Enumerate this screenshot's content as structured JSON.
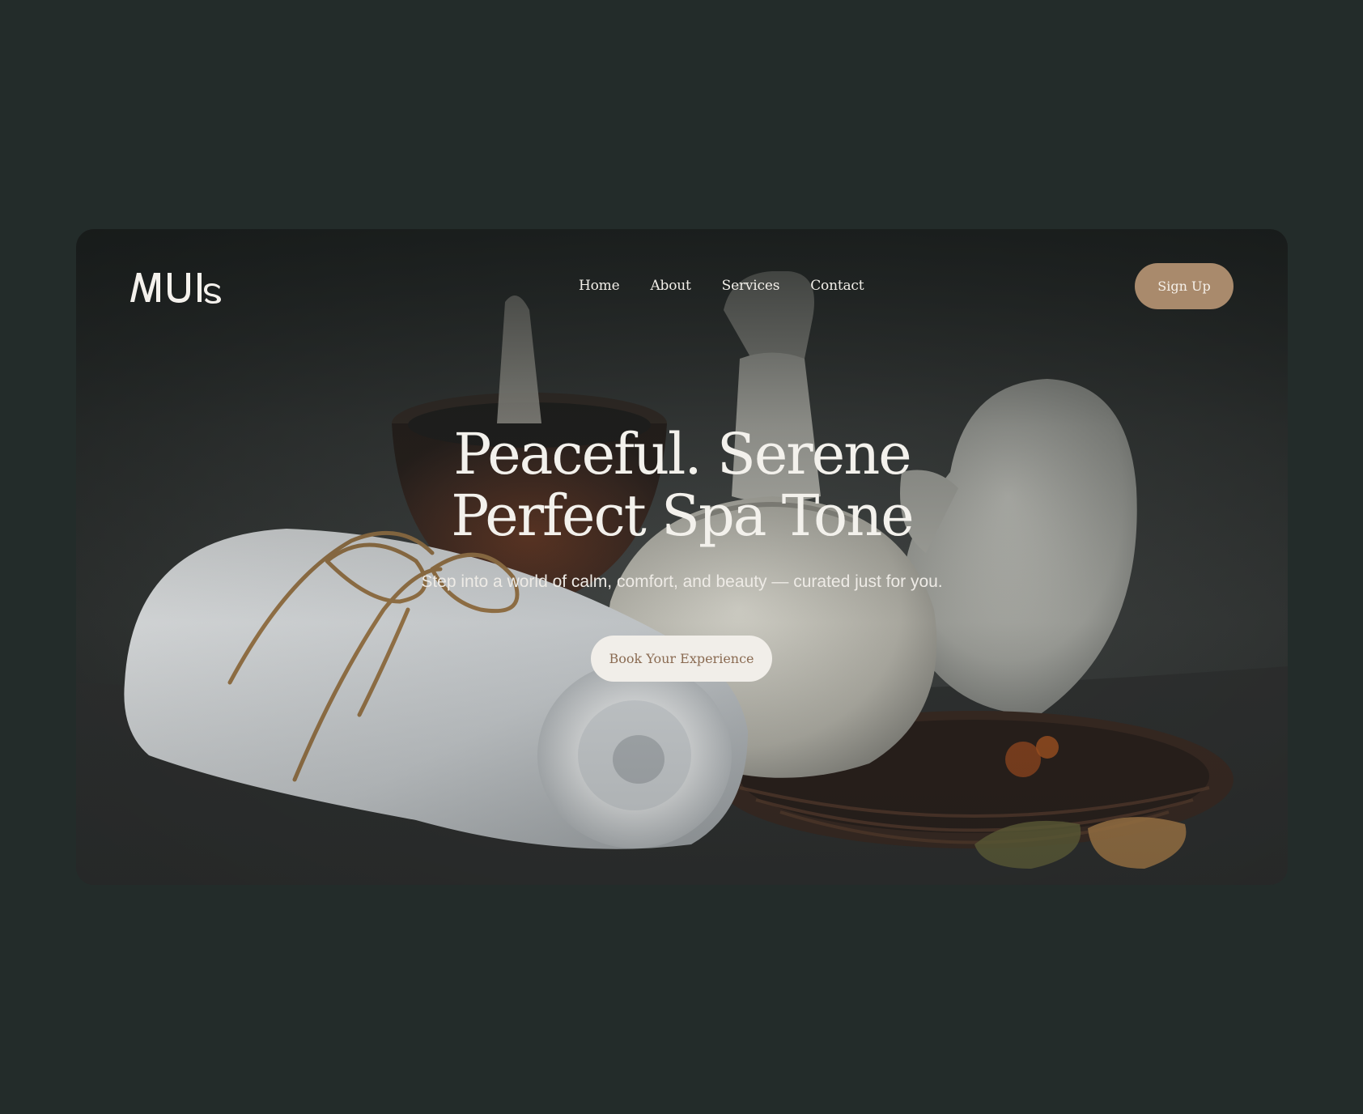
{
  "brand": {
    "logo_text": "MUIs"
  },
  "nav": {
    "items": [
      {
        "label": "Home"
      },
      {
        "label": "About"
      },
      {
        "label": "Services"
      },
      {
        "label": "Contact"
      }
    ],
    "signup_label": "Sign Up"
  },
  "hero": {
    "headline_line1": "Peaceful. Serene",
    "headline_line2": "Perfect Spa Tone",
    "subtitle": "Step into a world of calm, comfort, and beauty — curated just for you.",
    "cta_label": "Book Your Experience"
  },
  "colors": {
    "page_background": "#232c2a",
    "accent": "#a98a6c",
    "cta_background": "#f1eee9",
    "cta_text": "#8a6b52"
  }
}
